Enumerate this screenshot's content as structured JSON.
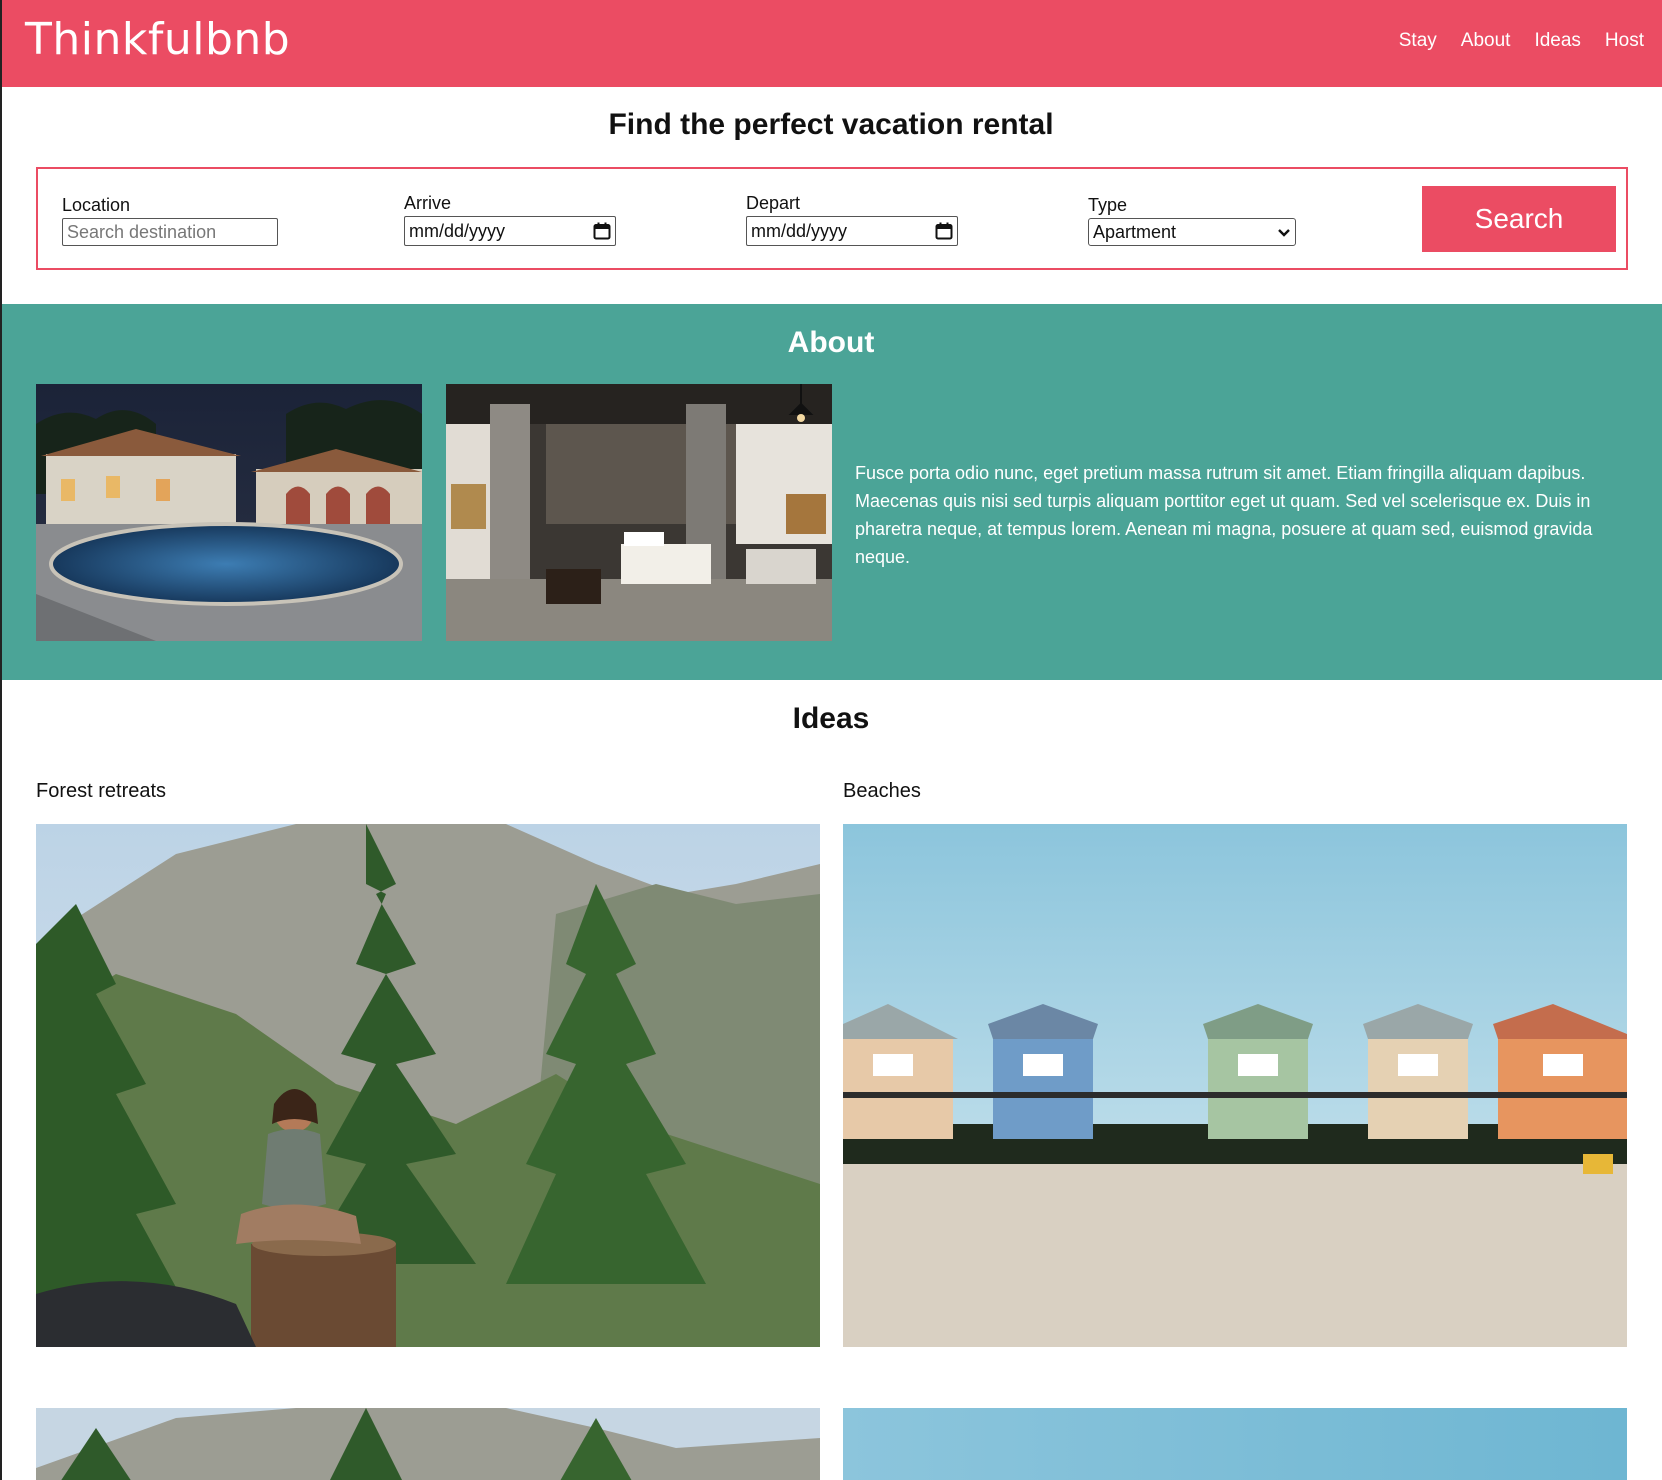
{
  "brand": "Thinkfulbnb",
  "nav": [
    "Stay",
    "About",
    "Ideas",
    "Host"
  ],
  "search": {
    "title": "Find the perfect vacation rental",
    "location_label": "Location",
    "location_placeholder": "Search destination",
    "arrive_label": "Arrive",
    "arrive_value": "mm/dd/yyyy",
    "depart_label": "Depart",
    "depart_value": "mm/dd/yyyy",
    "type_label": "Type",
    "type_value": "Apartment",
    "button": "Search"
  },
  "about": {
    "title": "About",
    "text": "Fusce porta odio nunc, eget pretium massa rutrum sit amet. Etiam fringilla aliquam dapibus. Maecenas quis nisi sed turpis aliquam porttitor eget ut quam. Sed vel scelerisque ex. Duis in pharetra neque, at tempus lorem. Aenean mi magna, posuere at quam sed, euismod gravida neque."
  },
  "ideas": {
    "title": "Ideas",
    "items": [
      {
        "label": "Forest retreats"
      },
      {
        "label": "Beaches"
      }
    ]
  },
  "colors": {
    "brand": "#eb4c63",
    "about_bg": "#4ba497"
  }
}
